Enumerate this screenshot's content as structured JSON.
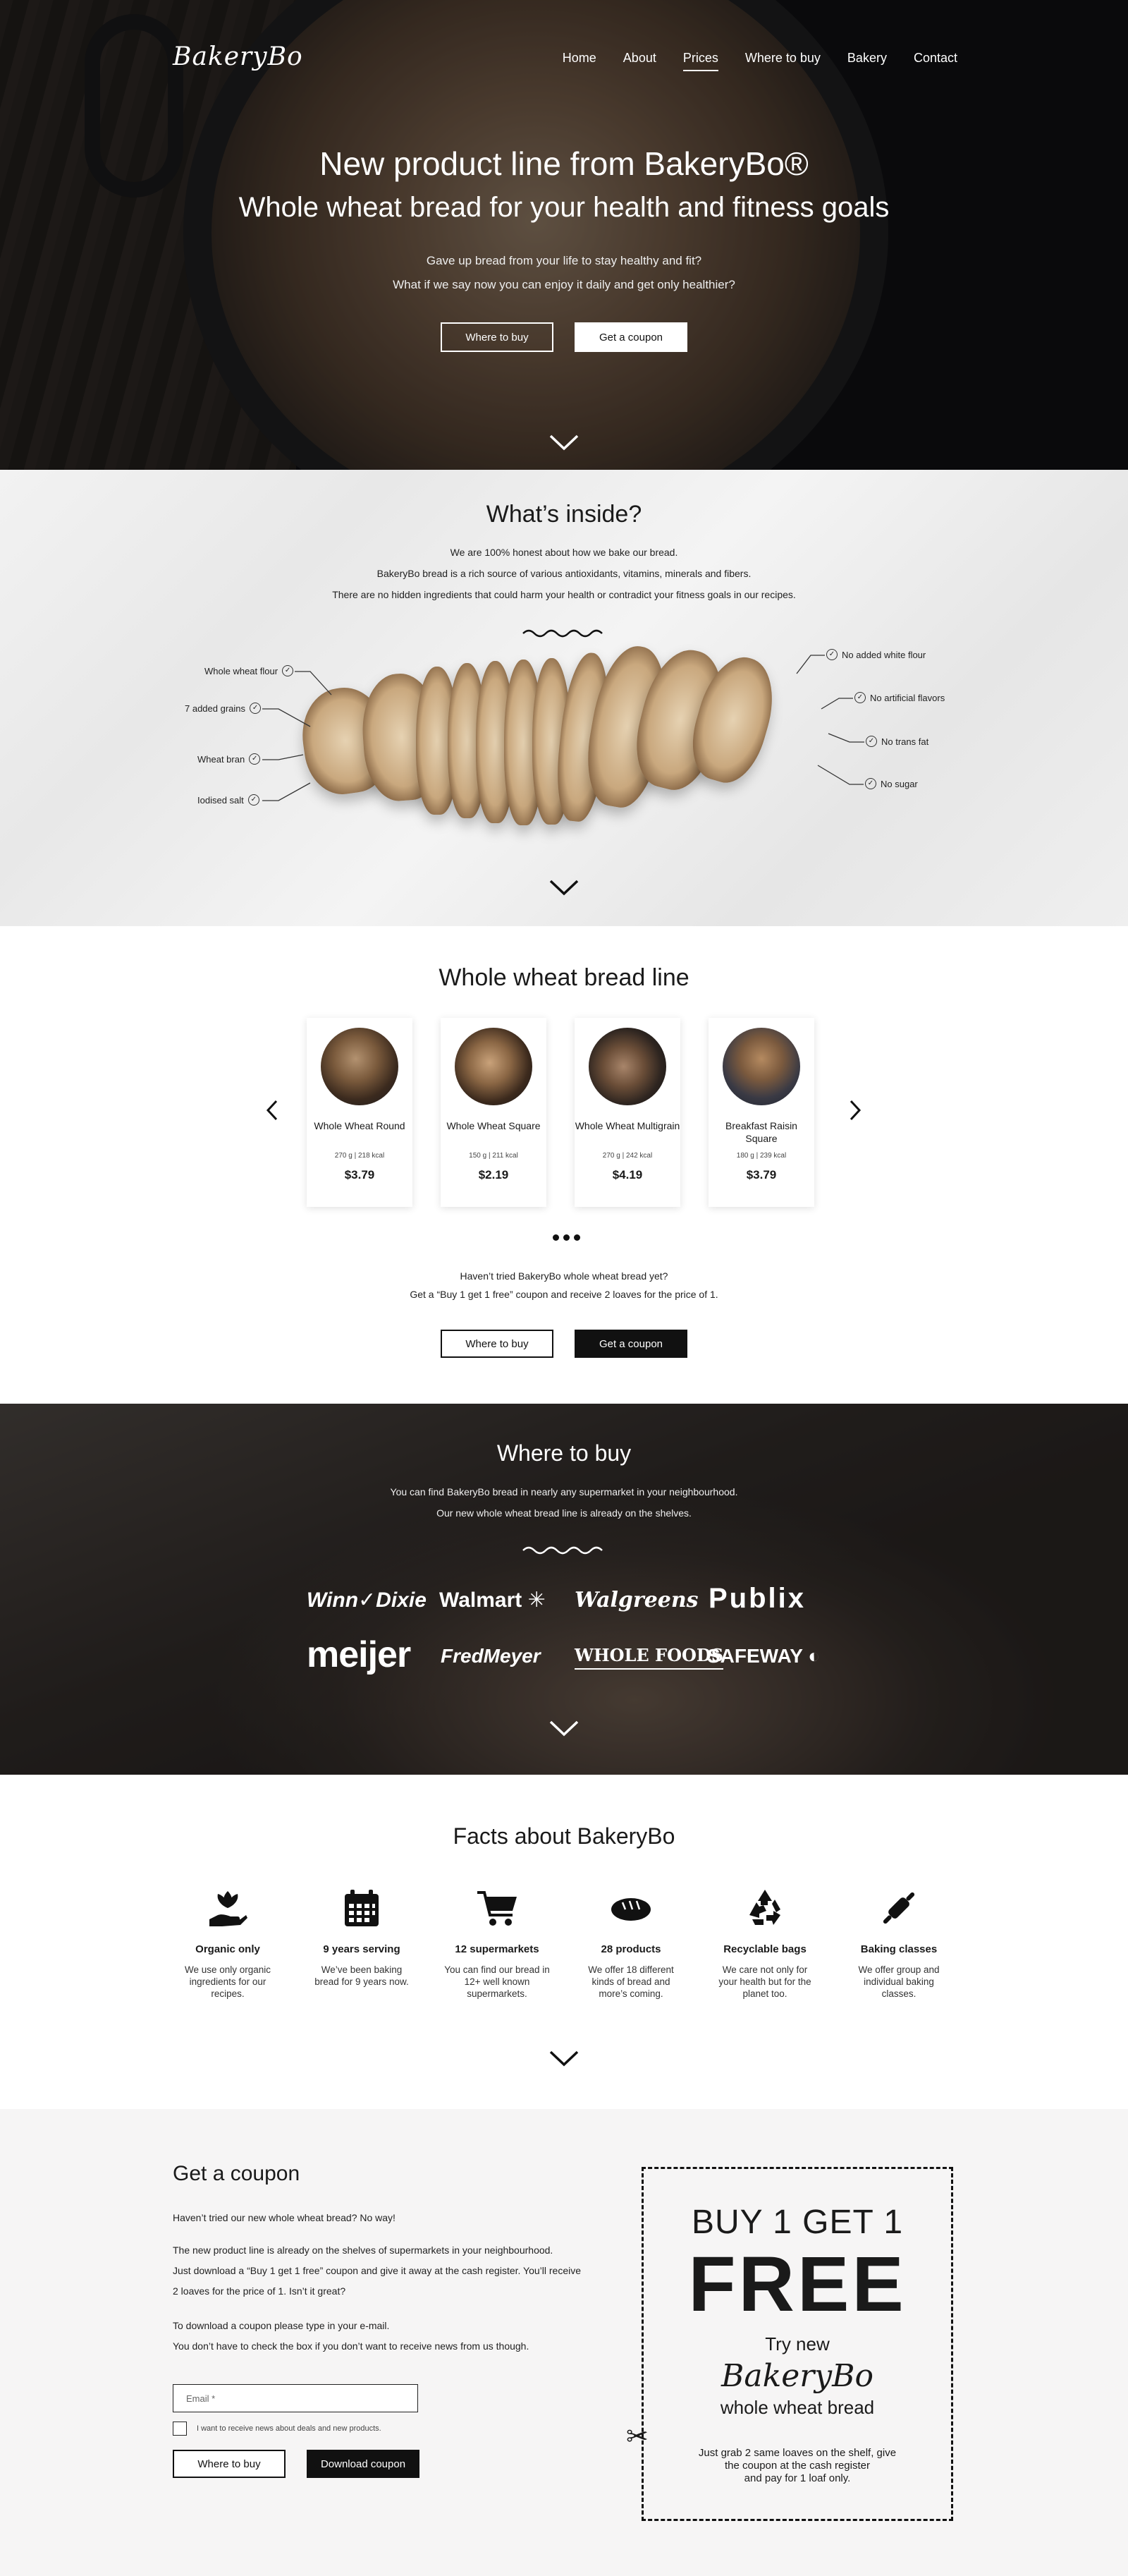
{
  "header": {
    "logo": "BakeryBo",
    "nav": [
      "Home",
      "About",
      "Prices",
      "Where to buy",
      "Bakery",
      "Contact"
    ],
    "active_nav": "Prices"
  },
  "hero": {
    "title": "New product line from BakeryBo®",
    "subtitle": "Whole wheat bread for your health and fitness goals",
    "line1": "Gave up bread from your life to stay healthy and fit?",
    "line2": "What if we say now you can enjoy it daily and get only healthier?",
    "btn_where": "Where to buy",
    "btn_coupon": "Get a coupon"
  },
  "inside": {
    "title": "What’s inside?",
    "line1": "We are 100% honest about how we bake our bread.",
    "line2": "BakeryBo bread is a rich source of various antioxidants, vitamins, minerals and fibers.",
    "line3": "There are no hidden ingredients that could harm your health or contradict your fitness goals in our recipes.",
    "ingredients": [
      "Whole wheat flour",
      "7 added grains",
      "Wheat bran",
      "Iodised salt"
    ],
    "free_of": [
      "No added white flour",
      "No artificial flavors",
      "No trans fat",
      "No sugar"
    ]
  },
  "breadline": {
    "title": "Whole wheat bread line",
    "products": [
      {
        "name": "Whole Wheat Round",
        "spec": "270 g | 218 kcal",
        "price": "$3.79"
      },
      {
        "name": "Whole Wheat Square",
        "spec": "150 g | 211 kcal",
        "price": "$2.19"
      },
      {
        "name": "Whole Wheat Multigrain",
        "spec": "270 g | 242 kcal",
        "price": "$4.19"
      },
      {
        "name": "Breakfast Raisin Square",
        "spec": "180 g | 239 kcal",
        "price": "$3.79"
      }
    ],
    "prev_icon": "chevron-left-icon",
    "next_icon": "chevron-right-icon",
    "line1": "Haven’t tried BakeryBo whole wheat bread yet?",
    "line2": "Get a “Buy 1 get 1 free” coupon and receive 2 loaves for the price of 1.",
    "btn_where": "Where to buy",
    "btn_coupon": "Get a coupon"
  },
  "where": {
    "title": "Where to buy",
    "line1": "You can find BakeryBo bread in nearly any supermarket in your neighbourhood.",
    "line2": "Our new whole wheat bread line is already on the shelves.",
    "stores": [
      "Winn✓Dixie",
      "Walmart",
      "Walgreens",
      "Publix",
      "meijer",
      "FredMeyer",
      "WHOLE FOODS",
      "SAFEWAY"
    ]
  },
  "facts": {
    "title": "Facts about BakeryBo",
    "items": [
      {
        "icon": "organic-hand-icon",
        "title": "Organic only",
        "text": "We use only organic ingredients for our recipes."
      },
      {
        "icon": "calendar-icon",
        "title": "9 years serving",
        "text": "We’ve been baking bread for 9 years now."
      },
      {
        "icon": "cart-icon",
        "title": "12 supermarkets",
        "text": "You can find our bread in 12+ well known supermarkets."
      },
      {
        "icon": "bread-icon",
        "title": "28 products",
        "text": "We offer 18 different kinds of bread and more’s coming."
      },
      {
        "icon": "recycle-icon",
        "title": "Recyclable bags",
        "text": "We care not only for your health but for the planet too."
      },
      {
        "icon": "rolling-pin-icon",
        "title": "Baking classes",
        "text": "We offer group and individual baking classes."
      }
    ]
  },
  "coupon": {
    "title": "Get a coupon",
    "p1": "Haven’t tried our new whole wheat bread? No way!",
    "p2a": "The new product line is already on the shelves of supermarkets in your neighbourhood.",
    "p2b": "Just download a “Buy 1 get 1 free” coupon and give it away at the cash register. You’ll receive",
    "p2c": "2 loaves for the price of 1. Isn’t it great?",
    "p3a": "To download a coupon please type in your e-mail.",
    "p3b": "You don’t have to check the box if you don’t want to receive news from us though.",
    "email_placeholder": "Email *",
    "checkbox_label": "I want to receive news about deals and new products.",
    "btn_where": "Where to buy",
    "btn_download": "Download coupon",
    "ticket": {
      "line1": "BUY 1 GET 1",
      "line2": "FREE",
      "line3": "Try new",
      "line4": "BakeryBo",
      "line5": "whole wheat bread",
      "line6a": "Just grab 2 same loaves on the shelf, give",
      "line6b": "the coupon at the cash register",
      "line6c": "and pay for 1 loaf only."
    }
  }
}
